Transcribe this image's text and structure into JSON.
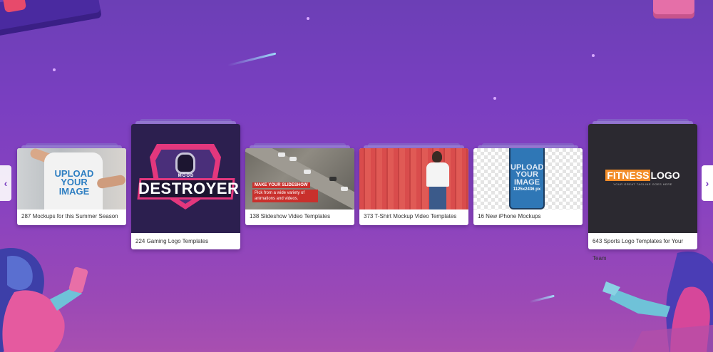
{
  "carousel": {
    "prev_label": "‹",
    "next_label": "›",
    "cards": [
      {
        "label": "287 Mockups for this Summer Season",
        "thumb_text": "UPLOAD YOUR IMAGE"
      },
      {
        "label": "224 Gaming Logo Templates",
        "thumb_text": "DESTROYER",
        "thumb_sub": "MOOD"
      },
      {
        "label": "138 Slideshow Video Templates",
        "thumb_text": "MAKE YOUR SLIDESHOW",
        "thumb_sub": "Pick from a wide variety of animations and videos."
      },
      {
        "label": "373 T-Shirt Mockup Video Templates"
      },
      {
        "label": "16 New iPhone Mockups",
        "thumb_text": "UPLOAD YOUR IMAGE",
        "thumb_sub": "1125x2436 px"
      },
      {
        "label": "643 Sports Logo Templates for Your Team",
        "thumb_text_a": "FITNESS",
        "thumb_text_b": "LOGO",
        "thumb_sub": "YOUR GREAT TAGLINE GOES HERE"
      }
    ]
  },
  "colors": {
    "background_top": "#6c3fb6",
    "background_bottom": "#a84fb0",
    "accent_pink": "#e3377d",
    "accent_orange": "#f28c28"
  },
  "icons": {
    "prev": "chevron-left-icon",
    "next": "chevron-right-icon"
  }
}
